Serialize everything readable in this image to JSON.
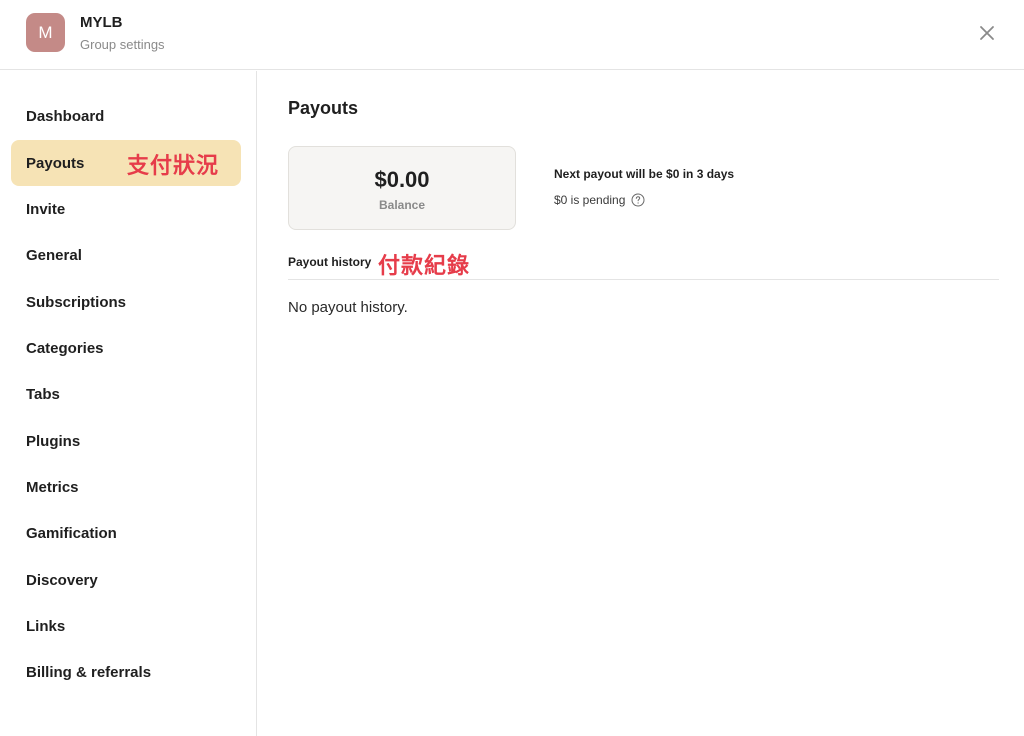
{
  "header": {
    "avatar_letter": "M",
    "group_name": "MYLB",
    "subtitle": "Group settings",
    "close_icon": "close-icon"
  },
  "sidebar": {
    "active": "Payouts",
    "items": [
      {
        "label": "Dashboard"
      },
      {
        "label": "Payouts"
      },
      {
        "label": "Invite"
      },
      {
        "label": "General"
      },
      {
        "label": "Subscriptions"
      },
      {
        "label": "Categories"
      },
      {
        "label": "Tabs"
      },
      {
        "label": "Plugins"
      },
      {
        "label": "Metrics"
      },
      {
        "label": "Gamification"
      },
      {
        "label": "Discovery"
      },
      {
        "label": "Links"
      },
      {
        "label": "Billing & referrals"
      }
    ]
  },
  "annotations": {
    "payouts_note": "支付狀況",
    "history_note": "付款紀錄"
  },
  "main": {
    "title": "Payouts",
    "balance": {
      "amount": "$0.00",
      "label": "Balance"
    },
    "next_payout": "Next payout will be $0 in 3 days",
    "pending": "$0 is pending",
    "help_icon": "question-circle-icon",
    "history_label": "Payout history",
    "empty_history": "No payout history."
  },
  "colors": {
    "avatar": "#c48a87",
    "active_nav": "#f6e3b5",
    "annotation": "#e63c4a",
    "card_bg": "#f6f5f3"
  }
}
